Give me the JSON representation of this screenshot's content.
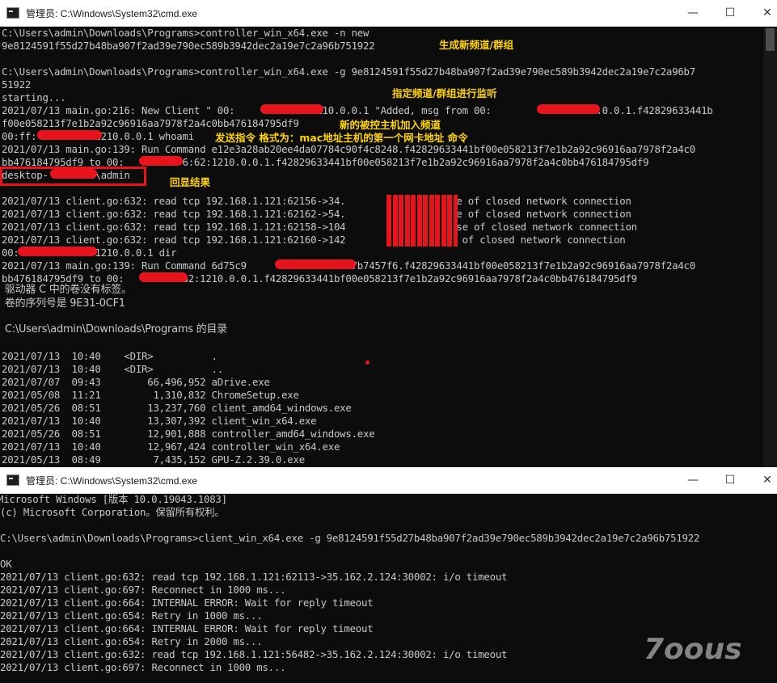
{
  "window1": {
    "title": "管理员: C:\\Windows\\System32\\cmd.exe",
    "lines": [
      "C:\\Users\\admin\\Downloads\\Programs>controller_win_x64.exe -n new",
      "9e8124591f55d27b48ba907f2ad39e790ec589b3942dec2a19e7c2a96b751922",
      "",
      "C:\\Users\\admin\\Downloads\\Programs>controller_win_x64.exe -g 9e8124591f55d27b48ba907f2ad39e790ec589b3942dec2a19e7c2a96b7",
      "51922",
      "starting...",
      "2021/07/13 main.go:216: New Client \" 00:          62:1210.0.0.1 \"Added, msg from 00:           62:1210.0.0.1.f42829633441b",
      "f00e058213f7e1b2a92c96916aa7978f2a4c0bb476184795df9",
      "00:ff:          1210.0.0.1 whoami",
      "2021/07/13 main.go:139: Run Command e12e3a28ab20ee4da07784c90f4c8248.f42829633441bf00e058213f7e1b2a92c96916aa7978f2a4c0",
      "bb476184795df9 to 00:          6:62:1210.0.0.1.f42829633441bf00e058213f7e1b2a92c96916aa7978f2a4c0bb476184795df9",
      "desktop-       i\\admin",
      "",
      "2021/07/13 client.go:632: read tcp 192.168.1.121:62156->34.          30002: use of closed network connection",
      "2021/07/13 client.go:632: read tcp 192.168.1.121:62162->54.          30002: use of closed network connection",
      "2021/07/13 client.go:632: read tcp 192.168.1.121:62158->104          :30002: use of closed network connection",
      "2021/07/13 client.go:632: read tcp 192.168.1.121:62160->142          0002: use of closed network connection",
      "00:             1210.0.0.1 dir",
      "2021/07/13 main.go:139: Run Command 6d75c9          055984157b7457f6.f42829633441bf00e058213f7e1b2a92c96916aa7978f2a4c0",
      "bb476184795df9 to 00:         :62:1210.0.0.1.f42829633441bf00e058213f7e1b2a92c96916aa7978f2a4c0bb476184795df9"
    ],
    "cn_lines": [
      " 驱动器 C 中的卷没有标签。",
      " 卷的序列号是 9E31-0CF1",
      "",
      " C:\\Users\\admin\\Downloads\\Programs 的目录"
    ],
    "dir_lines": [
      "2021/07/13  10:40    <DIR>          .",
      "2021/07/13  10:40    <DIR>          ..",
      "2021/07/07  09:43        66,496,952 aDrive.exe",
      "2021/05/08  11:21         1,310,832 ChromeSetup.exe",
      "2021/05/26  08:51        13,237,760 client_amd64_windows.exe",
      "2021/07/13  10:40        13,307,392 client_win_x64.exe",
      "2021/05/26  08:51        12,901,888 controller_amd64_windows.exe",
      "2021/07/13  10:40        12,967,424 controller_win_x64.exe",
      "2021/05/13  08:49         7,435,152 GPU-Z.2.39.0.exe"
    ],
    "annotations": {
      "new_channel": "生成新频道/群组",
      "listen": "指定频道/群组进行监听",
      "new_host": "新的被控主机加入频道",
      "send_cmd": "发送指令 格式为：mac地址主机的第一个网卡地址 命令",
      "echo": "回显结果"
    }
  },
  "window2": {
    "title": "管理员: C:\\Windows\\System32\\cmd.exe",
    "lines": [
      "Microsoft Windows [版本 10.0.19043.1083]",
      "(c) Microsoft Corporation。保留所有权利。",
      "",
      "C:\\Users\\admin\\Downloads\\Programs>client_win_x64.exe -g 9e8124591f55d27b48ba907f2ad39e790ec589b3942dec2a19e7c2a96b751922",
      "",
      "OK",
      "2021/07/13 client.go:632: read tcp 192.168.1.121:62113->35.162.2.124:30002: i/o timeout",
      "2021/07/13 client.go:697: Reconnect in 1000 ms...",
      "2021/07/13 client.go:664: INTERNAL ERROR: Wait for reply timeout",
      "2021/07/13 client.go:654: Retry in 1000 ms...",
      "2021/07/13 client.go:664: INTERNAL ERROR: Wait for reply timeout",
      "2021/07/13 client.go:654: Retry in 2000 ms...",
      "2021/07/13 client.go:632: read tcp 192.168.1.121:56482->35.162.2.124:30002: i/o timeout",
      "2021/07/13 client.go:697: Reconnect in 1000 ms..."
    ]
  },
  "titlebar_buttons": {
    "minimize": "—",
    "maximize": "☐",
    "close": "✕"
  },
  "watermark": "7oous",
  "colors": {
    "console_bg": "#0c0c0c",
    "console_fg": "#c8c8c8",
    "annotation": "#ffd400",
    "redaction": "#e8141b"
  }
}
